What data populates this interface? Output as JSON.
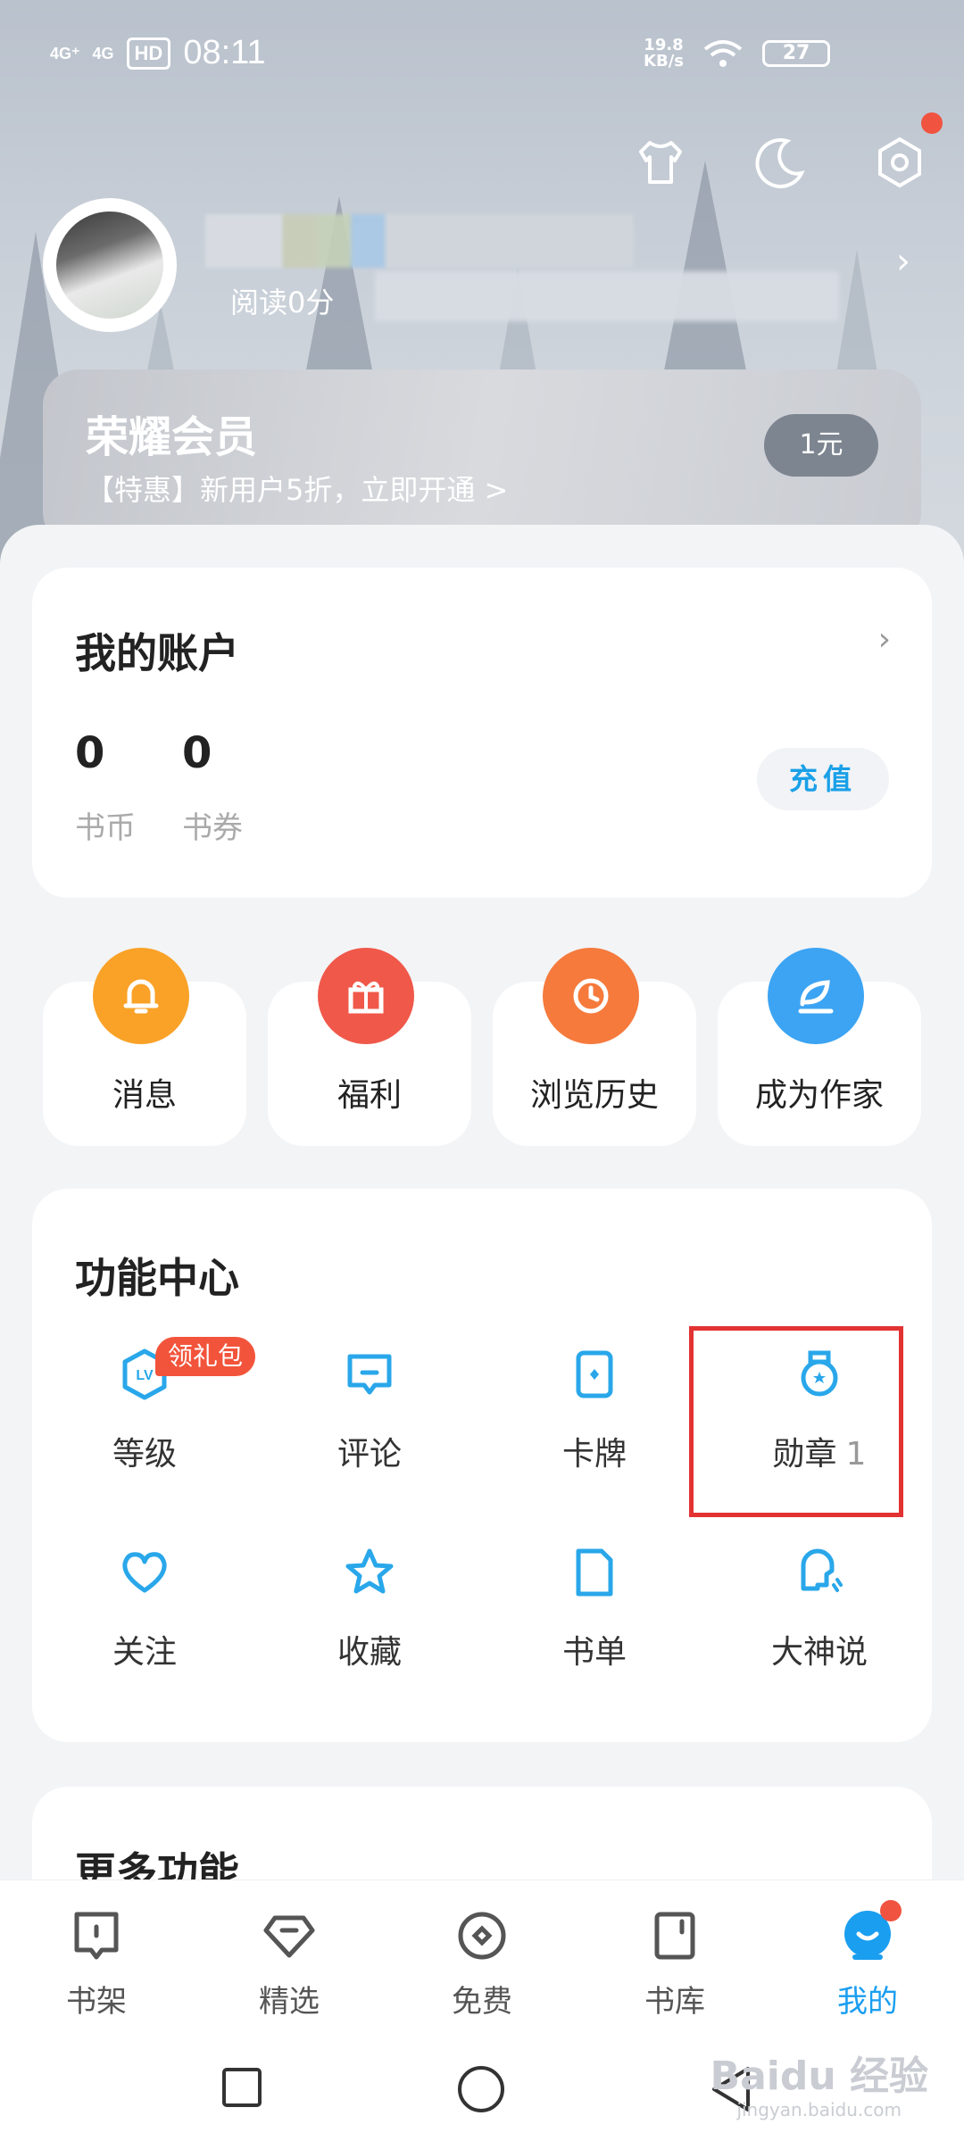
{
  "status_bar": {
    "network_1": "4G⁺",
    "network_2": "4G",
    "hd": "HD",
    "time": "08:11",
    "speed_value": "19.8",
    "speed_unit": "KB/s",
    "battery": "27"
  },
  "profile": {
    "read_time": "阅读0分",
    "chevron": "›"
  },
  "vip": {
    "title": "荣耀会员",
    "subtitle": "【特惠】新用户5折，立即开通 >",
    "button": "1元"
  },
  "account": {
    "title": "我的账户",
    "chevron": "›",
    "coins_value": "0",
    "coins_label": "书币",
    "vouchers_value": "0",
    "vouchers_label": "书券",
    "recharge": "充值"
  },
  "quick_actions": [
    {
      "label": "消息",
      "icon": "bell-icon",
      "color": "#f9a227"
    },
    {
      "label": "福利",
      "icon": "gift-icon",
      "color": "#f0584a"
    },
    {
      "label": "浏览历史",
      "icon": "clock-icon",
      "color": "#f57a3c"
    },
    {
      "label": "成为作家",
      "icon": "quill-icon",
      "color": "#3ca4f3"
    }
  ],
  "function_center": {
    "title": "功能中心",
    "gift_badge": "领礼包",
    "items": [
      {
        "label": "等级",
        "icon": "level-icon"
      },
      {
        "label": "评论",
        "icon": "comment-icon"
      },
      {
        "label": "卡牌",
        "icon": "card-icon"
      },
      {
        "label": "勋章",
        "count": "1",
        "icon": "medal-icon"
      },
      {
        "label": "关注",
        "icon": "heart-icon"
      },
      {
        "label": "收藏",
        "icon": "star-icon"
      },
      {
        "label": "书单",
        "icon": "booklist-icon"
      },
      {
        "label": "大神说",
        "icon": "speak-icon"
      }
    ]
  },
  "more": {
    "title": "更多功能"
  },
  "tabs": [
    {
      "label": "书架",
      "icon": "bookshelf-icon"
    },
    {
      "label": "精选",
      "icon": "featured-icon"
    },
    {
      "label": "免费",
      "icon": "free-icon"
    },
    {
      "label": "书库",
      "icon": "library-icon"
    },
    {
      "label": "我的",
      "icon": "profile-icon",
      "active": true
    }
  ],
  "watermark": {
    "main": "Baidu 经验",
    "sub": "jingyan.baidu.com"
  },
  "colors": {
    "accent": "#1a9ef0",
    "highlight": "#e23232",
    "badge": "#f2543b"
  }
}
